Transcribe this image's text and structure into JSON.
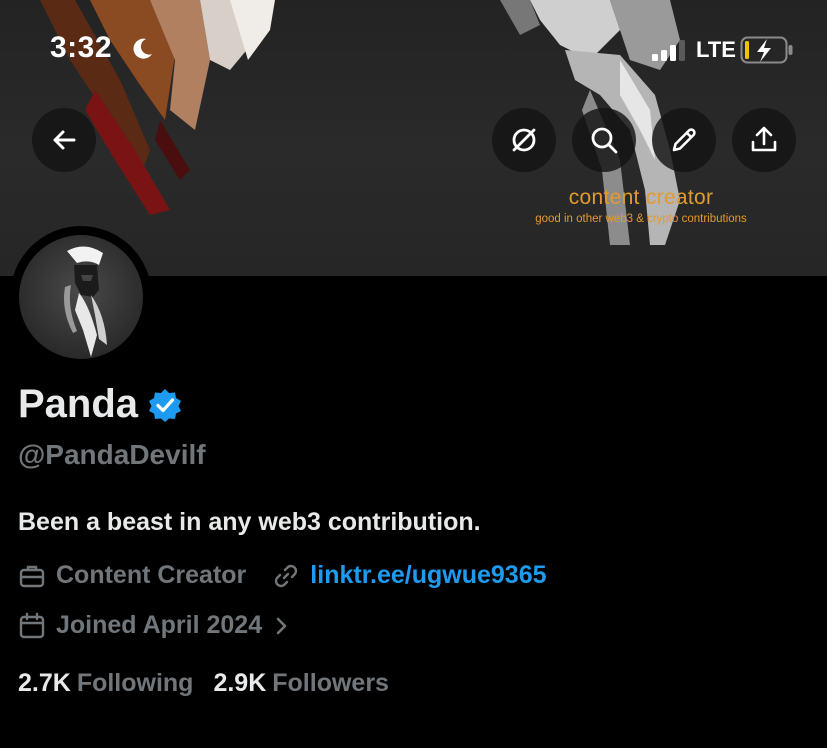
{
  "status_bar": {
    "time": "3:32",
    "network": "LTE"
  },
  "banner": {
    "caption_title": "content creator",
    "caption_sub": "good in other web3 & crypto contributions"
  },
  "actions": {
    "icons": [
      "back-arrow-icon",
      "explore-circle-icon",
      "search-icon",
      "edit-pencil-icon",
      "share-upload-icon"
    ]
  },
  "profile": {
    "name": "Panda",
    "handle": "@PandaDevilf",
    "bio": "Been a beast in any web3 contribution.",
    "category": "Content Creator",
    "link": "linktr.ee/ugwue9365",
    "joined": "Joined April 2024",
    "following_count": "2.7K",
    "following_label": "Following",
    "followers_count": "2.9K",
    "followers_label": "Followers"
  },
  "colors": {
    "background": "#000000",
    "text_primary": "#e7e9ea",
    "text_secondary": "#71767b",
    "link": "#1d9bf0",
    "verified": "#1d9bf0",
    "banner_caption": "#e39a2e"
  }
}
